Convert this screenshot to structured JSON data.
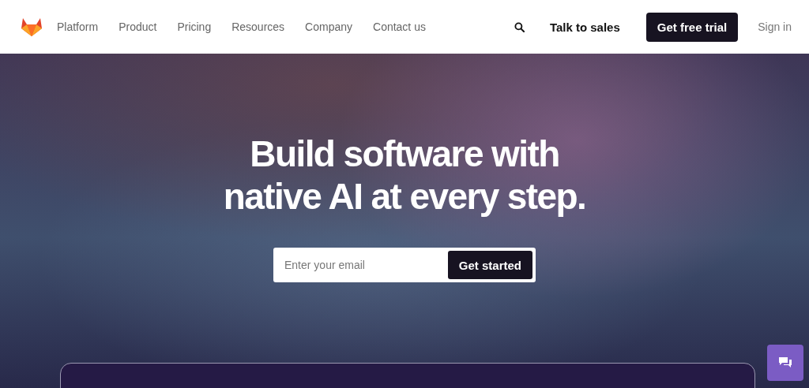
{
  "nav": {
    "items": [
      "Platform",
      "Product",
      "Pricing",
      "Resources",
      "Company",
      "Contact us"
    ],
    "talk_to_sales": "Talk to sales",
    "free_trial": "Get free trial",
    "sign_in": "Sign in"
  },
  "hero": {
    "headline_lines": [
      "Build software with",
      "native AI at every step."
    ],
    "email": {
      "placeholder": "Enter your email"
    },
    "cta": "Get started"
  }
}
